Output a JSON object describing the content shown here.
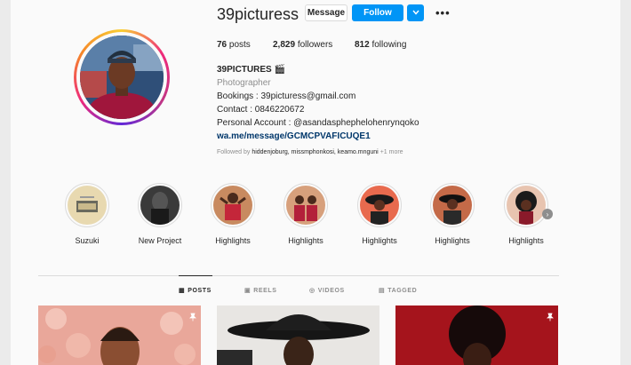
{
  "profile": {
    "username": "39picturess",
    "message_label": "Message",
    "follow_label": "Follow",
    "dropdown_icon": "chevron-down-icon",
    "more_icon": "more-options-icon",
    "more_glyph": "•••"
  },
  "stats": {
    "posts_count": "76",
    "posts_label": "posts",
    "followers_count": "2,829",
    "followers_label": "followers",
    "following_count": "812",
    "following_label": "following"
  },
  "bio": {
    "name": "39PICTURES 🎬",
    "category": "Photographer",
    "line1": "Bookings : 39picturess@gmail.com",
    "line2": "Contact : 0846220672",
    "line3": "Personal Account : @asandasphephelohenrynqoko",
    "link": "wa.me/message/GCMCPVAFICUQE1"
  },
  "followed_by": {
    "prefix": "Followed by",
    "names": "hiddenjoburg, missmphonkosi, keamo.mnguni",
    "more": "+1 more"
  },
  "highlights": [
    {
      "label": "Suzuki"
    },
    {
      "label": "New Project"
    },
    {
      "label": "Highlights"
    },
    {
      "label": "Highlights"
    },
    {
      "label": "Highlights"
    },
    {
      "label": "Highlights"
    },
    {
      "label": "Highlights"
    }
  ],
  "tabs": [
    {
      "label": "POSTS",
      "icon": "grid-icon",
      "glyph": "▦"
    },
    {
      "label": "REELS",
      "icon": "reels-icon",
      "glyph": "▣"
    },
    {
      "label": "VIDEOS",
      "icon": "video-icon",
      "glyph": "◎"
    },
    {
      "label": "TAGGED",
      "icon": "tag-icon",
      "glyph": "▤"
    }
  ],
  "colors": {
    "accent": "#0095f6",
    "link": "#00376b",
    "muted": "#8e8e8e"
  }
}
